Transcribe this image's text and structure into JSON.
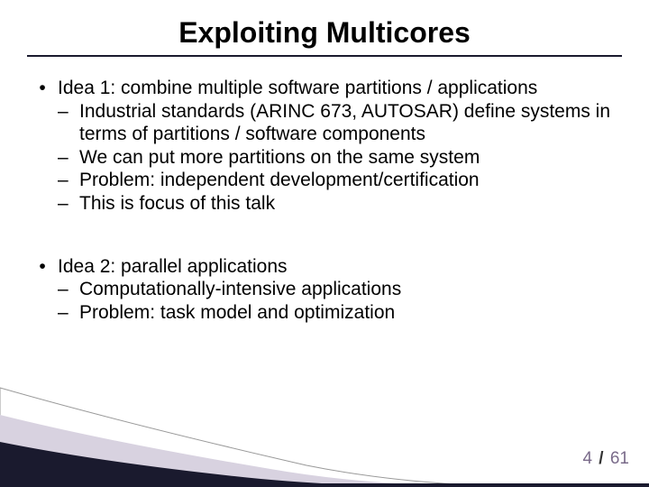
{
  "title": "Exploiting Multicores",
  "idea1": {
    "header": "Idea 1: combine multiple software partitions / applications",
    "subs": [
      "Industrial standards (ARINC 673, AUTOSAR) define systems in terms of partitions / software components",
      "We can put more partitions on the same system",
      "Problem: independent development/certification",
      "This is focus of this talk"
    ]
  },
  "idea2": {
    "header": "Idea 2: parallel applications",
    "subs": [
      "Computationally-intensive applications",
      "Problem: task model and optimization"
    ]
  },
  "page": {
    "current": "4",
    "total": "61"
  }
}
